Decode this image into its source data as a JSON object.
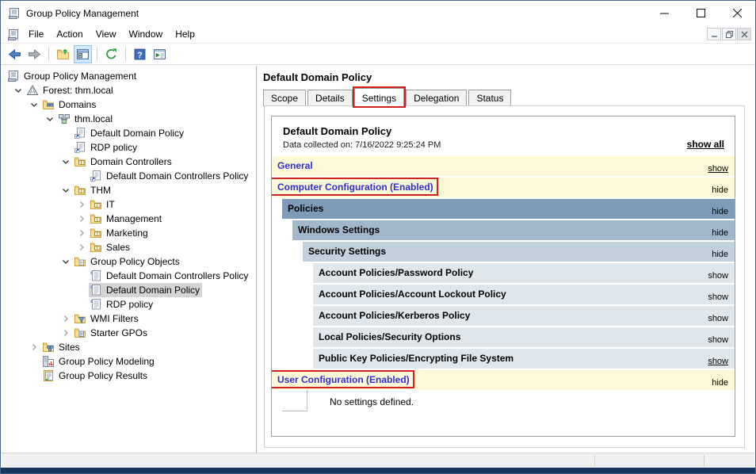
{
  "window": {
    "title": "Group Policy Management"
  },
  "titlebar": {
    "controls": [
      "minimize",
      "maximize",
      "close"
    ]
  },
  "menubar": {
    "items": [
      "File",
      "Action",
      "View",
      "Window",
      "Help"
    ],
    "mdi_controls": [
      "minimize",
      "restore",
      "close"
    ]
  },
  "toolbar": {
    "buttons": [
      {
        "name": "back",
        "icon": "back-icon"
      },
      {
        "name": "forward",
        "icon": "forward-icon"
      },
      {
        "sep": true
      },
      {
        "name": "export-list",
        "icon": "export-icon"
      },
      {
        "name": "show-console-tree",
        "icon": "console-tree-icon",
        "selected": true
      },
      {
        "sep": true
      },
      {
        "name": "refresh",
        "icon": "refresh-icon"
      },
      {
        "sep": true
      },
      {
        "name": "help",
        "icon": "help-icon"
      },
      {
        "name": "new-window",
        "icon": "new-window-icon"
      }
    ]
  },
  "tree": {
    "items": [
      {
        "label": "Group Policy Management",
        "level": 0,
        "expander": null,
        "icon": "gpmc-console-icon"
      },
      {
        "label": "Forest: thm.local",
        "level": 1,
        "expander": "expanded",
        "icon": "forest-icon"
      },
      {
        "label": "Domains",
        "level": 2,
        "expander": "expanded",
        "icon": "domains-folder-icon"
      },
      {
        "label": "thm.local",
        "level": 3,
        "expander": "expanded",
        "icon": "domain-icon"
      },
      {
        "label": "Default Domain Policy",
        "level": 4,
        "expander": null,
        "icon": "gpo-link-icon"
      },
      {
        "label": "RDP policy",
        "level": 4,
        "expander": null,
        "icon": "gpo-link-icon"
      },
      {
        "label": "Domain Controllers",
        "level": 4,
        "expander": "expanded",
        "icon": "ou-icon"
      },
      {
        "label": "Default Domain Controllers Policy",
        "level": 5,
        "expander": null,
        "icon": "gpo-link-icon"
      },
      {
        "label": "THM",
        "level": 4,
        "expander": "expanded",
        "icon": "ou-icon"
      },
      {
        "label": "IT",
        "level": 5,
        "expander": "collapsed",
        "icon": "ou-icon"
      },
      {
        "label": "Management",
        "level": 5,
        "expander": "collapsed",
        "icon": "ou-icon"
      },
      {
        "label": "Marketing",
        "level": 5,
        "expander": "collapsed",
        "icon": "ou-icon"
      },
      {
        "label": "Sales",
        "level": 5,
        "expander": "collapsed",
        "icon": "ou-icon"
      },
      {
        "label": "Group Policy Objects",
        "level": 4,
        "expander": "expanded",
        "icon": "gpo-folder-icon"
      },
      {
        "label": "Default Domain Controllers Policy",
        "level": 5,
        "expander": null,
        "icon": "gpo-icon"
      },
      {
        "label": "Default Domain Policy",
        "level": 5,
        "expander": null,
        "icon": "gpo-icon",
        "selected": true
      },
      {
        "label": "RDP policy",
        "level": 5,
        "expander": null,
        "icon": "gpo-icon"
      },
      {
        "label": "WMI Filters",
        "level": 4,
        "expander": "collapsed",
        "icon": "wmi-folder-icon"
      },
      {
        "label": "Starter GPOs",
        "level": 4,
        "expander": "collapsed",
        "icon": "starter-gpo-folder-icon"
      },
      {
        "label": "Sites",
        "level": 2,
        "expander": "collapsed",
        "icon": "sites-folder-icon"
      },
      {
        "label": "Group Policy Modeling",
        "level": 2,
        "expander": null,
        "icon": "modeling-icon"
      },
      {
        "label": "Group Policy Results",
        "level": 2,
        "expander": null,
        "icon": "results-icon"
      }
    ]
  },
  "content": {
    "title": "Default Domain Policy",
    "tabs": [
      {
        "label": "Scope"
      },
      {
        "label": "Details"
      },
      {
        "label": "Settings",
        "active": true,
        "annotated": true
      },
      {
        "label": "Delegation"
      },
      {
        "label": "Status"
      }
    ],
    "report": {
      "title": "Default Domain Policy",
      "collected": "Data collected on: 7/16/2022 9:25:24 PM",
      "show_all": "show all",
      "sections": [
        {
          "label": "General",
          "style": "yellow",
          "indent": 0,
          "action": "show",
          "action_underline": true,
          "label_blue": true
        },
        {
          "label": "Computer Configuration (Enabled)",
          "style": "yellow",
          "indent": 0,
          "action": "hide",
          "label_blue": true,
          "annotated": true
        },
        {
          "label": "Policies",
          "style": "blue_1",
          "indent": 1,
          "action": "hide"
        },
        {
          "label": "Windows Settings",
          "style": "blue_2",
          "indent": 2,
          "action": "hide"
        },
        {
          "label": "Security Settings",
          "style": "blue_3",
          "indent": 3,
          "action": "hide"
        },
        {
          "label": "Account Policies/Password Policy",
          "style": "blue_4",
          "indent": 4,
          "action": "show"
        },
        {
          "label": "Account Policies/Account Lockout Policy",
          "style": "blue_4",
          "indent": 4,
          "action": "show"
        },
        {
          "label": "Account Policies/Kerberos Policy",
          "style": "blue_4",
          "indent": 4,
          "action": "show"
        },
        {
          "label": "Local Policies/Security Options",
          "style": "blue_4",
          "indent": 4,
          "action": "show"
        },
        {
          "label": "Public Key Policies/Encrypting File System",
          "style": "blue_4",
          "indent": 4,
          "action": "show",
          "action_underline": true
        },
        {
          "label": "User Configuration (Enabled)",
          "style": "yellow",
          "indent": 0,
          "action": "hide",
          "label_blue": true,
          "annotated": true
        },
        {
          "label": "No settings defined.",
          "style": "empty",
          "indent": 1
        }
      ]
    }
  },
  "colors": {
    "band_yellow": "#fdf8d7",
    "band_blue_1": "#7e9cba",
    "band_blue_2": "#a2b7ca",
    "band_blue_3": "#c3d1dc",
    "band_blue_4": "#dfe7ed",
    "heading_blue": "#2e2ed2",
    "annotation_red": "#d21f1f",
    "bottom_strip_navy": "#17365d",
    "toolbar_selected_blue": "#cde8ff"
  }
}
